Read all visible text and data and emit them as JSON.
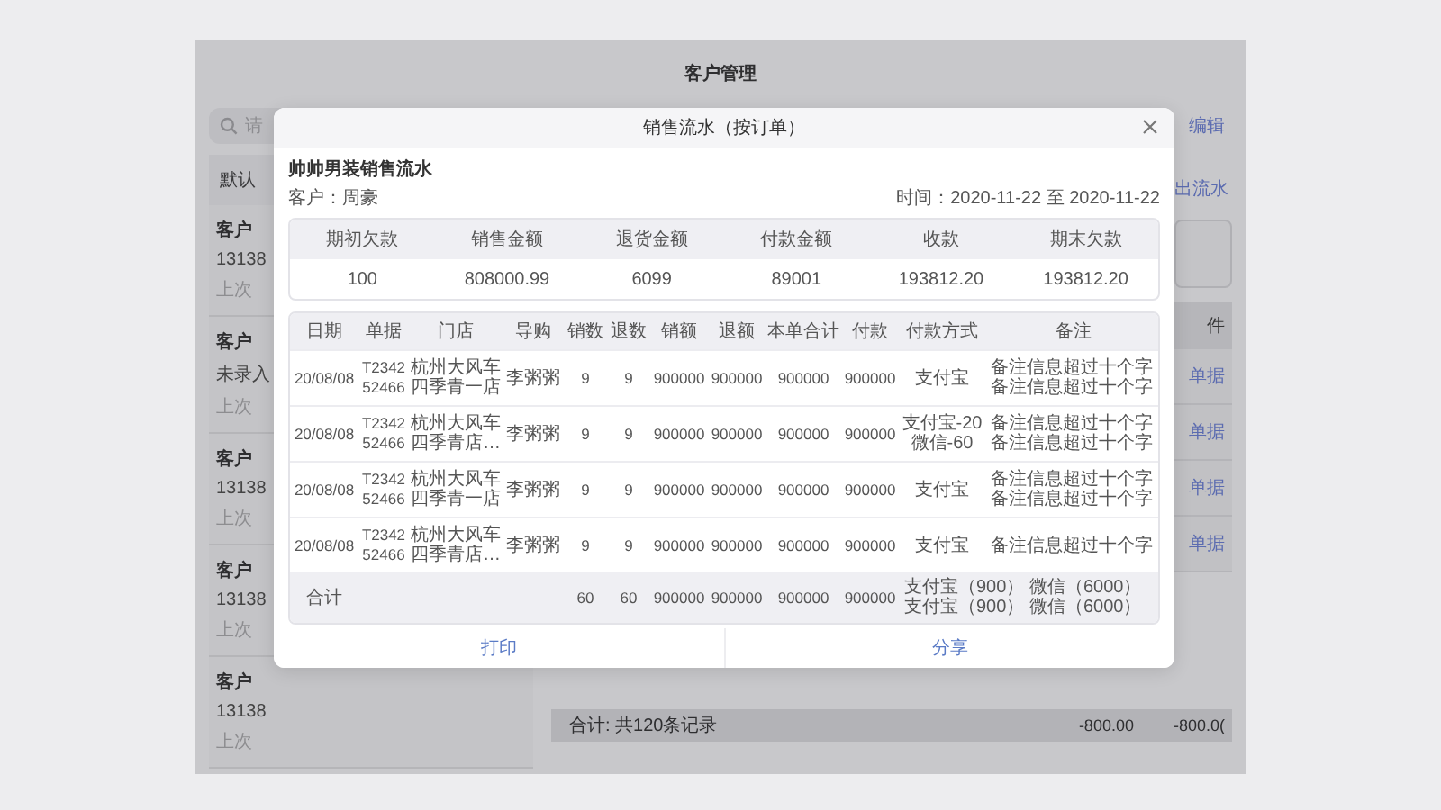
{
  "background": {
    "title": "客户管理",
    "search_placeholder": "请",
    "edit_link": "编辑",
    "tab": "默认",
    "customers": [
      {
        "name": "客户",
        "phone": "13138",
        "last": "上次"
      },
      {
        "name": "客户",
        "phone": "未录入",
        "last": "上次"
      },
      {
        "name": "客户",
        "phone": "13138",
        "last": "上次"
      },
      {
        "name": "客户",
        "phone": "13138",
        "last": "上次"
      },
      {
        "name": "客户",
        "phone": "13138",
        "last": "上次"
      }
    ],
    "flow_link": "出流水",
    "table_header": "件",
    "row_links": [
      "单据",
      "单据",
      "单据",
      "单据"
    ],
    "footer": {
      "summary": "合计: 共120条记录",
      "values": [
        "-800.00",
        "-800.0("
      ]
    }
  },
  "dialog": {
    "title": "销售流水（按订单）",
    "heading": "帅帅男装销售流水",
    "customer": "客户：周豪",
    "period": "时间：2020-11-22 至 2020-11-22",
    "summary": {
      "columns": [
        "期初欠款",
        "销售金额",
        "退货金额",
        "付款金额",
        "收款",
        "期末欠款"
      ],
      "values": [
        "100",
        "808000.99",
        "6099",
        "89001",
        "193812.20",
        "193812.20"
      ]
    },
    "orders": {
      "columns": [
        "日期",
        "单据",
        "门店",
        "导购",
        "销数",
        "退数",
        "销额",
        "退额",
        "本单合计",
        "付款",
        "付款方式",
        "备注"
      ],
      "rows": [
        [
          "20/08/08",
          [
            "T2342",
            "52466"
          ],
          [
            "杭州大风车",
            "四季青一店"
          ],
          "李粥粥",
          "9",
          "9",
          "900000",
          "900000",
          "900000",
          "900000",
          "支付宝",
          [
            "备注信息超过十个字",
            "备注信息超过十个字"
          ]
        ],
        [
          "20/08/08",
          [
            "T2342",
            "52466"
          ],
          [
            "杭州大风车",
            "四季青店…"
          ],
          "李粥粥",
          "9",
          "9",
          "900000",
          "900000",
          "900000",
          "900000",
          [
            "支付宝-20",
            "微信-60"
          ],
          [
            "备注信息超过十个字",
            "备注信息超过十个字"
          ]
        ],
        [
          "20/08/08",
          [
            "T2342",
            "52466"
          ],
          [
            "杭州大风车",
            "四季青一店"
          ],
          "李粥粥",
          "9",
          "9",
          "900000",
          "900000",
          "900000",
          "900000",
          "支付宝",
          [
            "备注信息超过十个字",
            "备注信息超过十个字"
          ]
        ],
        [
          "20/08/08",
          [
            "T2342",
            "52466"
          ],
          [
            "杭州大风车",
            "四季青店…"
          ],
          "李粥粥",
          "9",
          "9",
          "900000",
          "900000",
          "900000",
          "900000",
          "支付宝",
          "备注信息超过十个字"
        ]
      ],
      "total": {
        "label": "合计",
        "values": [
          "60",
          "60",
          "900000",
          "900000",
          "900000",
          "900000"
        ],
        "payment": [
          "支付宝（900） 微信（6000）",
          "支付宝（900） 微信（6000）"
        ]
      }
    },
    "buttons": [
      "打印",
      "分享"
    ]
  }
}
